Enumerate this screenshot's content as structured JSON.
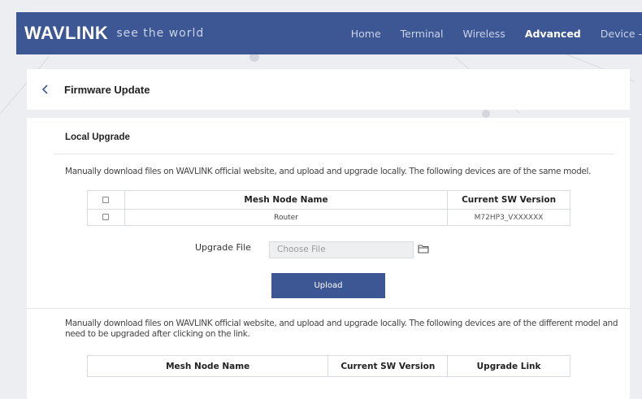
{
  "header": {
    "logo": "WAVLINK",
    "tagline": "see the world",
    "nav": [
      "Home",
      "Terminal",
      "Wireless",
      "Advanced",
      "Device -"
    ],
    "active_nav": "Advanced",
    "bg_color": "#3d5794"
  },
  "title_bar": {
    "back_icon": "chevron-left-icon",
    "title": "Firmware Update"
  },
  "local_upgrade": {
    "section_title": "Local Upgrade",
    "desc_same_model": "Manually download files on WAVLINK official website, and upload and upgrade locally. The following devices are of the same model.",
    "table": {
      "headers": [
        "",
        "Mesh Node Name",
        "Current SW Version"
      ],
      "rows": [
        {
          "checked": false,
          "name": "Router",
          "version": "M72HP3_VXXXXXX"
        }
      ]
    },
    "upgrade_file_label": "Upgrade File",
    "file_placeholder": "Choose File",
    "folder_icon": "folder-icon",
    "upload_label": "Upload",
    "desc_diff_line1": "Manually download files on WAVLINK official website, and upload and upgrade locally. The following devices are of the different model and",
    "desc_diff_line2": "need to be upgraded after clicking on the link.",
    "table2": {
      "headers": [
        "Mesh Node Name",
        "Current SW Version",
        "Upgrade Link"
      ]
    }
  },
  "colors": {
    "accent": "#3d5794",
    "background": "#eceef2"
  }
}
